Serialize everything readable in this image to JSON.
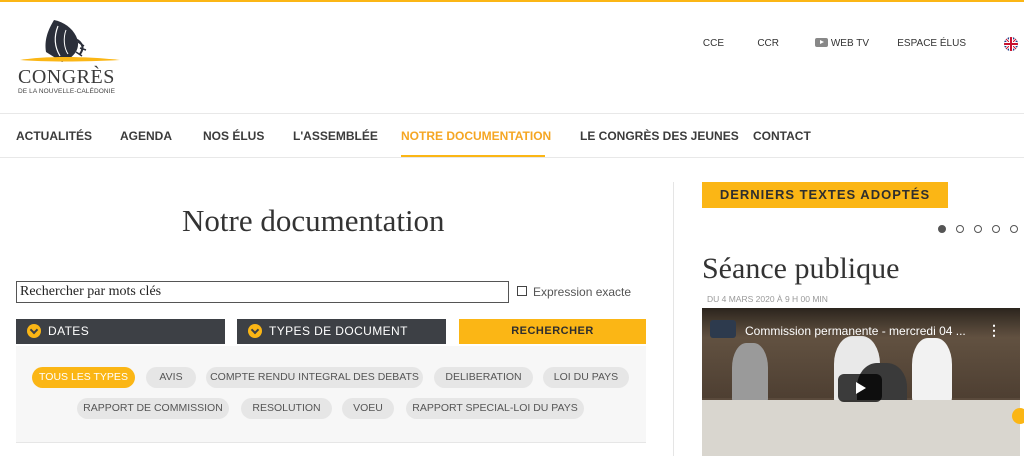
{
  "header": {
    "logo_title": "CONGRÈS",
    "logo_subtitle": "DE LA NOUVELLE-CALÉDONIE",
    "top_links": [
      {
        "label": "CCE"
      },
      {
        "label": "CCR"
      },
      {
        "label": "WEB TV",
        "icon": "youtube-icon"
      },
      {
        "label": "ESPACE ÉLUS"
      }
    ],
    "language_icon": "uk-flag-icon"
  },
  "nav": {
    "items": [
      {
        "label": "ACTUALITÉS"
      },
      {
        "label": "AGENDA"
      },
      {
        "label": "NOS ÉLUS"
      },
      {
        "label": "L'ASSEMBLÉE"
      },
      {
        "label": "NOTRE DOCUMENTATION",
        "active": true
      },
      {
        "label": "LE CONGRÈS DES JEUNES"
      },
      {
        "label": "CONTACT"
      }
    ]
  },
  "main": {
    "title": "Notre documentation",
    "search": {
      "placeholder": "Rechercher par mots clés",
      "value": ""
    },
    "exact_label": "Expression exacte",
    "dropdown_dates": "DATES",
    "dropdown_types": "TYPES DE DOCUMENT",
    "search_button": "RECHERCHER",
    "types": [
      {
        "label": "TOUS LES TYPES",
        "active": true
      },
      {
        "label": "AVIS"
      },
      {
        "label": "COMPTE RENDU INTEGRAL DES DEBATS"
      },
      {
        "label": "DELIBERATION"
      },
      {
        "label": "LOI DU PAYS"
      },
      {
        "label": "RAPPORT DE COMMISSION"
      },
      {
        "label": "RESOLUTION"
      },
      {
        "label": "VOEU"
      },
      {
        "label": "RAPPORT SPECIAL-LOI DU PAYS"
      }
    ]
  },
  "sidebar": {
    "badge": "DERNIERS TEXTES ADOPTÉS",
    "carousel": {
      "count": 5,
      "active": 0
    },
    "article_title": "Séance publique",
    "article_date": "DU 4 MARS 2020 À 9 H 00 MIN",
    "video": {
      "title": "Commission permanente - mercredi 04 ...",
      "channel_logo": "CONGRÈS"
    }
  },
  "colors": {
    "accent": "#fbb615",
    "dark": "#3d4045",
    "text": "#333333"
  }
}
